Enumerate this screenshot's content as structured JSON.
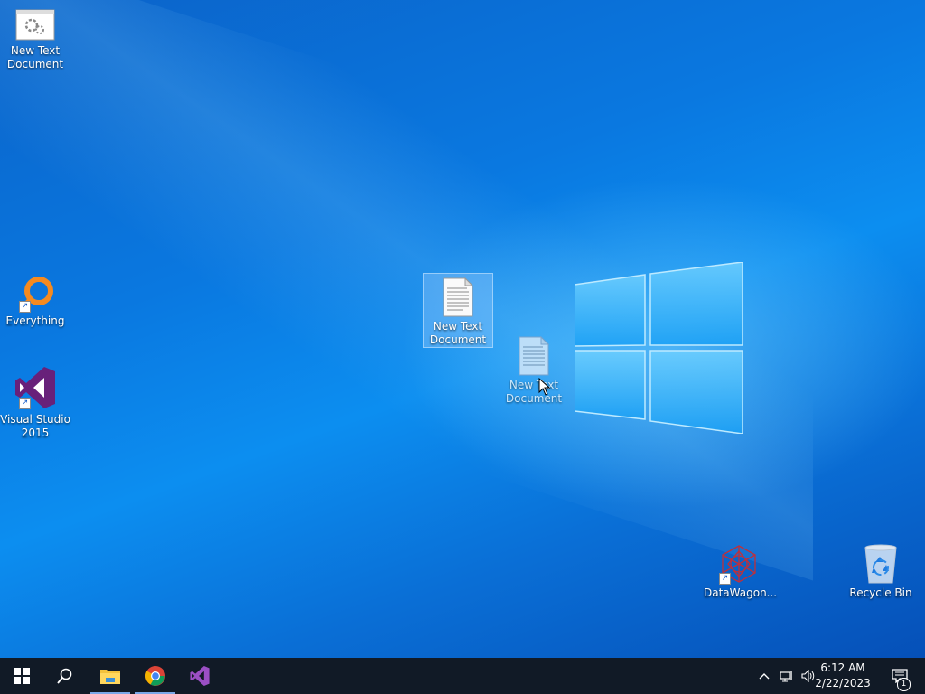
{
  "desktop": {
    "icons": [
      {
        "label": "New Text Document",
        "icon": "settings-file-icon"
      },
      {
        "label": "Everything",
        "icon": "everything-search-icon",
        "shortcut": true
      },
      {
        "label": "Visual Studio 2015",
        "icon": "visual-studio-icon",
        "shortcut": true
      },
      {
        "label": "New Text Document",
        "icon": "text-document-icon",
        "selected": true
      },
      {
        "label": "New Text Document",
        "icon": "text-document-icon",
        "dragging": true
      },
      {
        "label": "DataWagon...",
        "icon": "datawagon-icon",
        "shortcut": true
      },
      {
        "label": "Recycle Bin",
        "icon": "recycle-bin-icon"
      }
    ]
  },
  "taskbar": {
    "start": "windows-start-icon",
    "search": "search-icon",
    "pinned": [
      {
        "name": "file-explorer",
        "active": true
      },
      {
        "name": "chrome",
        "active": true
      },
      {
        "name": "visual-studio",
        "active": false
      }
    ],
    "tray": {
      "time": "6:12 AM",
      "date": "2/22/2023",
      "notification_count": "1"
    }
  },
  "colors": {
    "taskbar": "#111a26",
    "desktop_accent": "#0a78e0"
  }
}
